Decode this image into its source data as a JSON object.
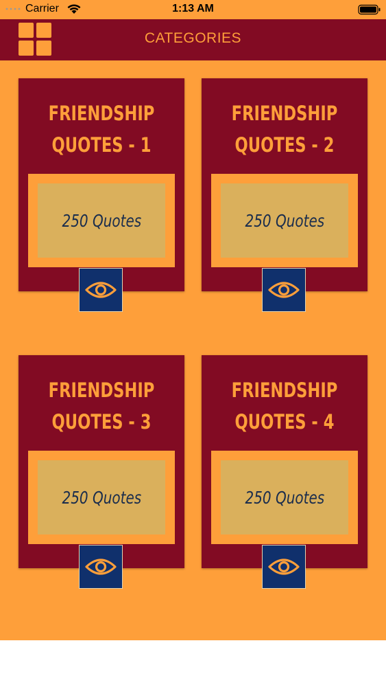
{
  "status_bar": {
    "carrier": "Carrier",
    "time": "1:13 AM"
  },
  "header": {
    "title": "CATEGORIES",
    "menu_icon": "grid-menu-icon"
  },
  "colors": {
    "background": "#fe9f3a",
    "header": "#820b23",
    "card": "#820b23",
    "accent": "#fe9f3a",
    "count_box": "#dab05c",
    "count_text": "#1a2d4d",
    "view_button": "#10306c"
  },
  "categories": [
    {
      "title_line1": "FRIENDSHIP",
      "title_line2": "QUOTES - 1",
      "count": "250 Quotes",
      "icon": "eye-icon"
    },
    {
      "title_line1": "FRIENDSHIP",
      "title_line2": "QUOTES - 2",
      "count": "250 Quotes",
      "icon": "eye-icon"
    },
    {
      "title_line1": "FRIENDSHIP",
      "title_line2": "QUOTES - 3",
      "count": "250 Quotes",
      "icon": "eye-icon"
    },
    {
      "title_line1": "FRIENDSHIP",
      "title_line2": "QUOTES - 4",
      "count": "250 Quotes",
      "icon": "eye-icon"
    }
  ]
}
